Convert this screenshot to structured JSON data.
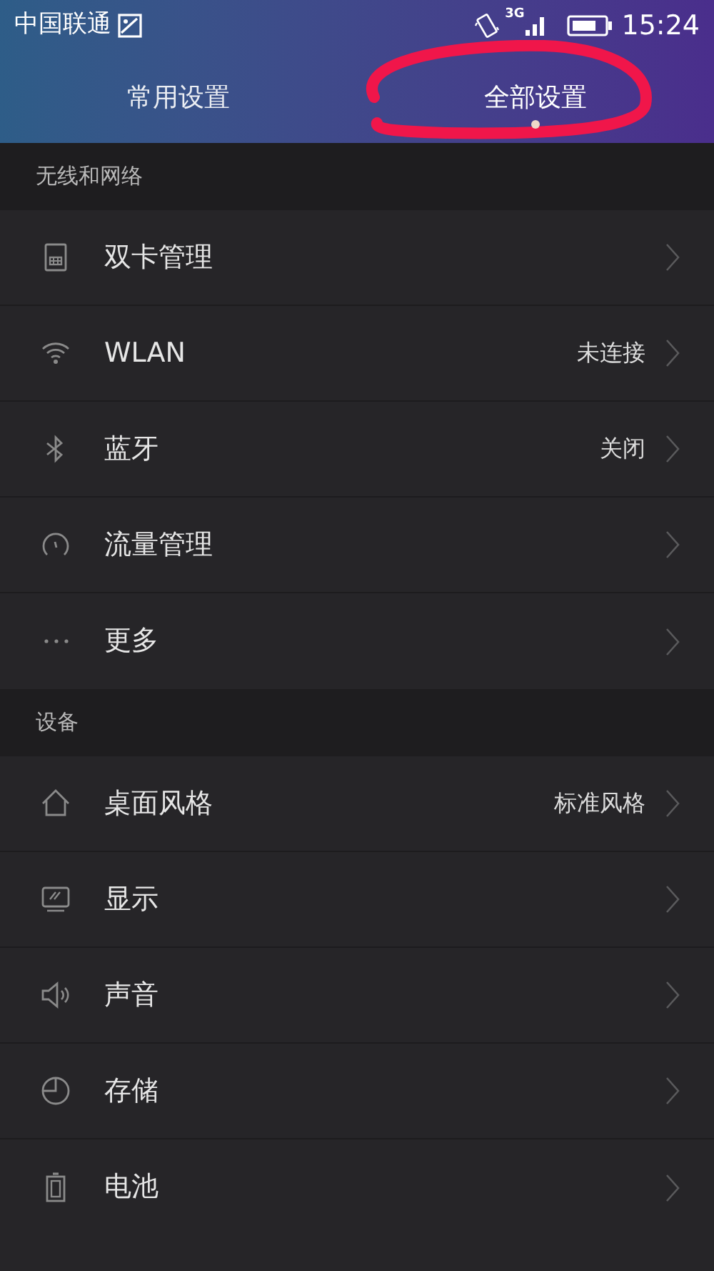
{
  "status_bar": {
    "carrier": "中国联通",
    "network": "3G",
    "time": "15:24"
  },
  "tabs": [
    {
      "label": "常用设置",
      "selected": false
    },
    {
      "label": "全部设置",
      "selected": true
    }
  ],
  "sections": [
    {
      "title": "无线和网络",
      "items": [
        {
          "kind": "sim",
          "label": "双卡管理"
        },
        {
          "kind": "wifi",
          "label": "WLAN",
          "value": "未连接"
        },
        {
          "kind": "bluetooth",
          "label": "蓝牙",
          "value": "关闭"
        },
        {
          "kind": "gauge",
          "label": "流量管理"
        },
        {
          "kind": "more",
          "label": "更多"
        }
      ]
    },
    {
      "title": "设备",
      "items": [
        {
          "kind": "home",
          "label": "桌面风格",
          "value": "标准风格"
        },
        {
          "kind": "display",
          "label": "显示"
        },
        {
          "kind": "sound",
          "label": "声音"
        },
        {
          "kind": "storage",
          "label": "存储"
        },
        {
          "kind": "battery",
          "label": "电池"
        }
      ]
    }
  ]
}
